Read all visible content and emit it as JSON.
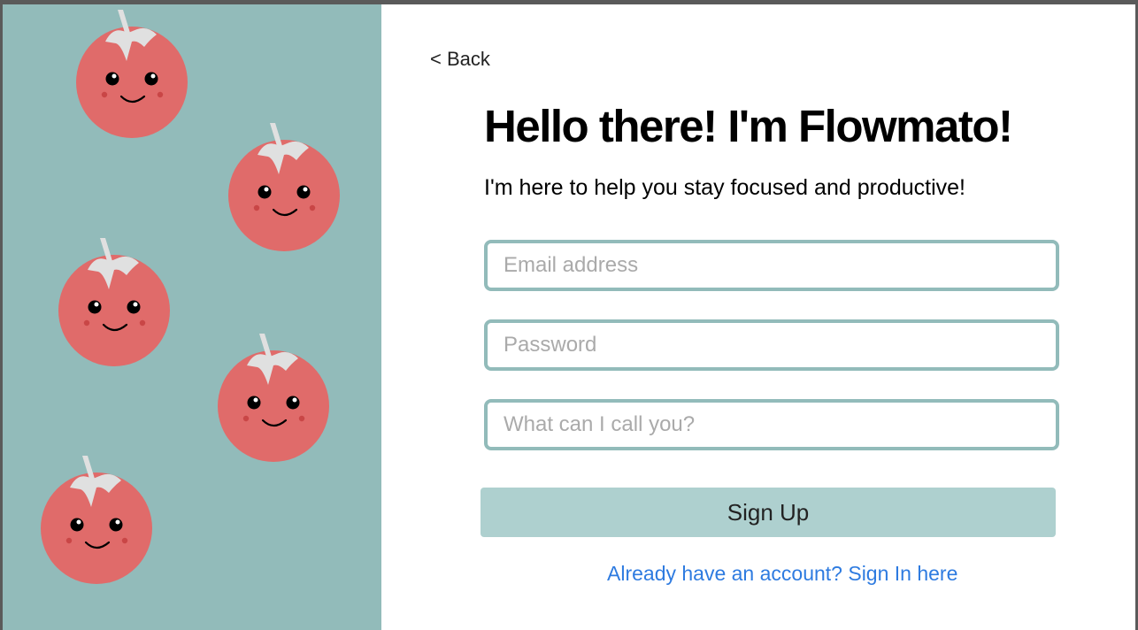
{
  "colors": {
    "sidebar_bg": "#92bbba",
    "tomato_red": "#e06b6a",
    "tomato_stem": "#e0e0e0",
    "input_border": "#92bbba",
    "button_bg": "#aed0cf",
    "link_blue": "#2e7be0"
  },
  "sidebar": {
    "illustration": "smiling-tomato-mascot",
    "tomato_count": 5
  },
  "header": {
    "back_label": "< Back"
  },
  "main": {
    "title": "Hello there! I'm Flowmato!",
    "subtitle": "I'm here to help you stay focused and productive!"
  },
  "form": {
    "email": {
      "placeholder": "Email address",
      "value": ""
    },
    "password": {
      "placeholder": "Password",
      "value": ""
    },
    "name": {
      "placeholder": "What can I call you?",
      "value": ""
    },
    "submit_label": "Sign Up",
    "signin_link": "Already have an account? Sign In here"
  }
}
